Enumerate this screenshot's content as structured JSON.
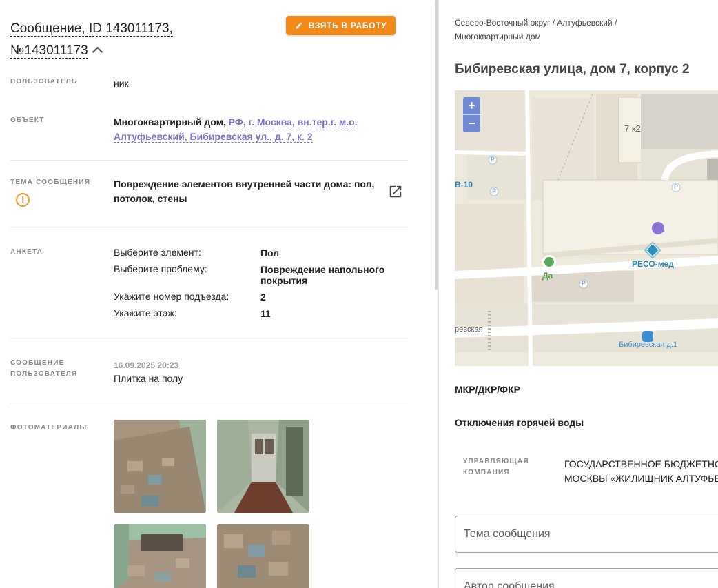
{
  "message": {
    "title_line1": "Сообщение, ID 143011173,",
    "title_line2": "№143011173",
    "take_button": "ВЗЯТЬ В РАБОТУ"
  },
  "fields": {
    "user_label": "ПОЛЬЗОВАТЕЛЬ",
    "user_value": "ник",
    "object_label": "ОБЪЕКТ",
    "object_type": "Многоквартирный дом,",
    "object_address_line1": "РФ, г. Москва, вн.тер.г. м.о.",
    "object_address_line2": "Алтуфьевский, Бибиревская ул., д. 7, к. 2",
    "topic_label": "ТЕМА СООБЩЕНИЯ",
    "topic_value_line1": "Повреждение элементов внутренней части дома: пол,",
    "topic_value_line2": "потолок, стены",
    "survey_label": "АНКЕТА",
    "survey": [
      {
        "key": "Выберите элемент:",
        "value": "Пол"
      },
      {
        "key": "Выберите проблему:",
        "value": "Повреждение напольного покрытия"
      },
      {
        "key": "Укажите номер подъезда:",
        "value": "2"
      },
      {
        "key": "Укажите этаж:",
        "value": "11"
      }
    ],
    "user_message_label_line1": "СООБЩЕНИЕ",
    "user_message_label_line2": "ПОЛЬЗОВАТЕЛЯ",
    "user_message_date": "16.09.2025 20:23",
    "user_message_text": "Плитка на полу",
    "photos_label": "ФОТОМАТЕРИАЛЫ"
  },
  "right": {
    "breadcrumb_line1": "Северо-Восточный округ / Алтуфьевский /",
    "breadcrumb_line2": "Многоквартирный дом",
    "address": "Бибиревская улица, дом 7, корпус 2",
    "map": {
      "zoom_in": "+",
      "zoom_out": "−",
      "building_label": "7 к2",
      "road_label": "В-10",
      "parking": "P",
      "poi_reso": "РЕСО-мед",
      "poi_da": "Да",
      "street": "ревская",
      "bus_stop": "Бибиревская д.1"
    },
    "section_mkr": "МКР/ДКР/ФКР",
    "section_water": "Отключения горячей воды",
    "uk_label_line1": "УПРАВЛЯЮЩАЯ",
    "uk_label_line2": "КОМПАНИЯ",
    "uk_value_line1": "ГОСУДАРСТВЕННОЕ БЮДЖЕТНОЕ",
    "uk_value_line2": "МОСКВЫ «ЖИЛИЩНИК АЛТУФЬЕВ",
    "field_topic": "Тема сообщения",
    "field_author": "Автор сообщения"
  },
  "colors": {
    "accent_orange": "#f38a17",
    "link_purple": "#7b72c4",
    "map_marker": "#8b74d6",
    "zoom_blue": "#6f8bd6"
  }
}
